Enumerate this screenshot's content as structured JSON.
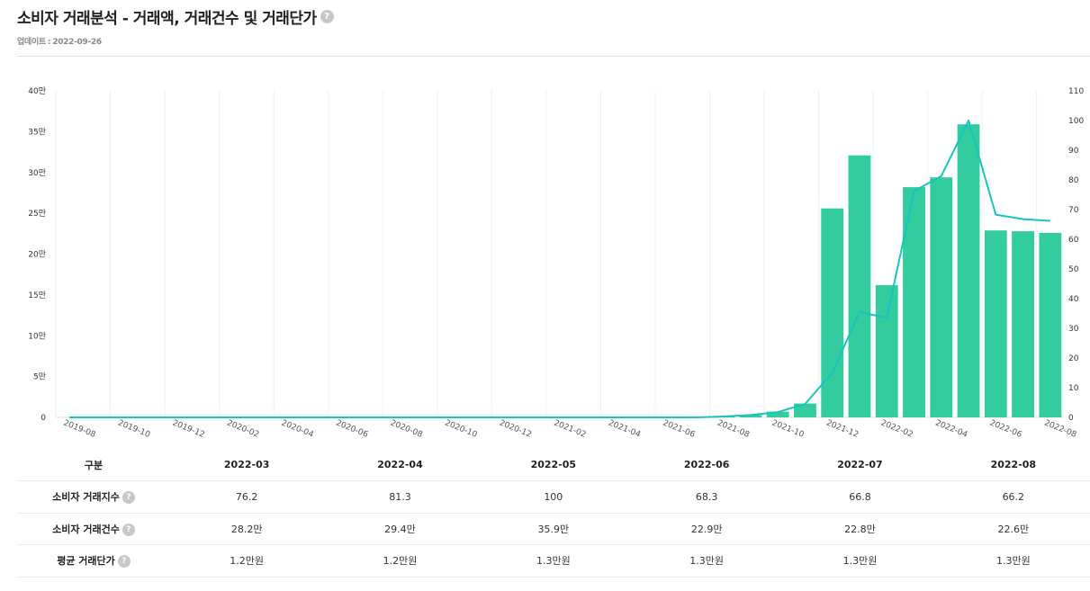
{
  "header": {
    "title": "소비자 거래분석 - 거래액, 거래건수 및 거래단가",
    "help_glyph": "?",
    "updated_label": "업데이트",
    "updated_sep": ":",
    "updated_date": "2022-09-26"
  },
  "colors": {
    "bar": "#33cc9f",
    "line": "#17c4c0",
    "grid": "#efefef",
    "axis_text": "#333333"
  },
  "chart_data": {
    "type": "bar+line",
    "x": [
      "2019-08",
      "2019-09",
      "2019-10",
      "2019-11",
      "2019-12",
      "2020-01",
      "2020-02",
      "2020-03",
      "2020-04",
      "2020-05",
      "2020-06",
      "2020-07",
      "2020-08",
      "2020-09",
      "2020-10",
      "2020-11",
      "2020-12",
      "2021-01",
      "2021-02",
      "2021-03",
      "2021-04",
      "2021-05",
      "2021-06",
      "2021-07",
      "2021-08",
      "2021-09",
      "2021-10",
      "2021-11",
      "2021-12",
      "2022-01",
      "2022-02",
      "2022-03",
      "2022-04",
      "2022-05",
      "2022-06",
      "2022-07",
      "2022-08"
    ],
    "x_tick_labels": [
      "2019-08",
      "2019-10",
      "2019-12",
      "2020-02",
      "2020-04",
      "2020-06",
      "2020-08",
      "2020-10",
      "2020-12",
      "2021-02",
      "2021-04",
      "2021-06",
      "2021-08",
      "2021-10",
      "2021-12",
      "2022-02",
      "2022-04",
      "2022-06",
      "2022-08"
    ],
    "series": [
      {
        "kind": "bar",
        "axis": "left",
        "values": [
          0,
          0,
          0,
          0,
          0,
          0,
          0,
          0,
          0,
          0,
          0,
          0,
          0,
          0,
          0,
          0,
          0,
          0,
          0,
          0,
          0,
          0,
          0,
          0,
          0.1,
          0.3,
          0.7,
          1.7,
          25.6,
          32.1,
          16.2,
          28.2,
          29.4,
          35.9,
          22.9,
          22.8,
          22.6
        ]
      },
      {
        "kind": "line",
        "axis": "right",
        "values": [
          0,
          0,
          0,
          0,
          0,
          0,
          0,
          0,
          0,
          0,
          0,
          0,
          0,
          0,
          0,
          0,
          0,
          0,
          0,
          0,
          0,
          0,
          0,
          0,
          0.3,
          0.8,
          1.8,
          4.5,
          15.0,
          35.5,
          33.5,
          76.2,
          81.3,
          100,
          68.3,
          66.8,
          66.2
        ]
      }
    ],
    "left_axis": {
      "ylim": [
        0,
        40
      ],
      "ticks": [
        0,
        5,
        10,
        15,
        20,
        25,
        30,
        35,
        40
      ],
      "tick_labels": [
        "0",
        "5만",
        "10만",
        "15만",
        "20만",
        "25만",
        "30만",
        "35만",
        "40만"
      ]
    },
    "right_axis": {
      "ylim": [
        0,
        110
      ],
      "ticks": [
        0,
        10,
        20,
        30,
        40,
        50,
        60,
        70,
        80,
        90,
        100,
        110
      ],
      "tick_labels": [
        "0",
        "10",
        "20",
        "30",
        "40",
        "50",
        "60",
        "70",
        "80",
        "90",
        "100",
        "110"
      ]
    },
    "grid": true,
    "legend": "none"
  },
  "table": {
    "header_label": "구분",
    "columns": [
      "2022-03",
      "2022-04",
      "2022-05",
      "2022-06",
      "2022-07",
      "2022-08"
    ],
    "rows": [
      {
        "label": "소비자 거래지수",
        "help": true,
        "values": [
          "76.2",
          "81.3",
          "100",
          "68.3",
          "66.8",
          "66.2"
        ]
      },
      {
        "label": "소비자 거래건수",
        "help": true,
        "values": [
          "28.2만",
          "29.4만",
          "35.9만",
          "22.9만",
          "22.8만",
          "22.6만"
        ]
      },
      {
        "label": "평균 거래단가",
        "help": true,
        "values": [
          "1.2만원",
          "1.2만원",
          "1.3만원",
          "1.3만원",
          "1.3만원",
          "1.3만원"
        ]
      }
    ]
  }
}
